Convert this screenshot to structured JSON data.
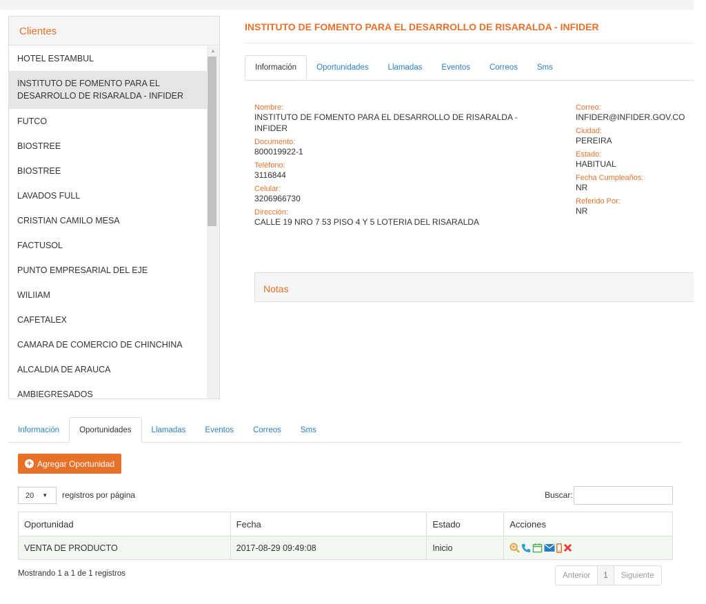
{
  "clients": {
    "header": "Clientes",
    "items": [
      "HOTEL ESTAMBUL",
      "INSTITUTO DE FOMENTO PARA EL DESARROLLO DE RISARALDA - INFIDER",
      "FUTCO",
      "BIOSTREE",
      "BIOSTREE",
      "LAVADOS FULL",
      "CRISTIAN CAMILO MESA",
      "FACTUSOL",
      "PUNTO EMPRESARIAL DEL EJE",
      "WILIIAM",
      "CAFETALEX",
      "CAMARA DE COMERCIO DE CHINCHINA",
      "ALCALDIA DE ARAUCA",
      "AMBIEGRESADOS"
    ],
    "selected_index": 1
  },
  "detail": {
    "title": "INSTITUTO DE FOMENTO PARA EL DESARROLLO DE RISARALDA - INFIDER",
    "tabs": [
      "Información",
      "Oportunidades",
      "Llamadas",
      "Eventos",
      "Correos",
      "Sms"
    ],
    "active_tab": "Información",
    "left": {
      "nombre_label": "Nombre:",
      "nombre": "INSTITUTO DE FOMENTO PARA EL DESARROLLO DE RISARALDA - INFIDER",
      "documento_label": "Documento:",
      "documento": "800019922-1",
      "telefono_label": "Teléfono:",
      "telefono": "3116844",
      "celular_label": "Celular:",
      "celular": "3206966730",
      "direccion_label": "Dirección:",
      "direccion": "CALLE 19 NRO 7 53 PISO 4 Y 5 LOTERIA DEL RISARALDA"
    },
    "right": {
      "correo_label": "Correo:",
      "correo": "INFIDER@INFIDER.GOV.CO",
      "ciudad_label": "Ciudad:",
      "ciudad": "PEREIRA",
      "estado_label": "Estado:",
      "estado": "HABITUAL",
      "cumple_label": "Fecha Cumpleaños:",
      "cumple": "NR",
      "referido_label": "Referido Por:",
      "referido": "NR"
    },
    "notes_label": "Notas"
  },
  "opportunities": {
    "tabs": [
      "Información",
      "Oportunidades",
      "Llamadas",
      "Eventos",
      "Correos",
      "Sms"
    ],
    "active_tab": "Oportunidades",
    "add_label": "Agregar Oportunidad",
    "page_length": "20",
    "page_length_label": "registros por página",
    "search_label": "Buscar:",
    "search_value": "",
    "columns": [
      "Oportunidad",
      "Fecha",
      "Estado",
      "Acciones"
    ],
    "rows": [
      {
        "oportunidad": "VENTA DE PRODUCTO",
        "fecha": "2017-08-29 09:49:08",
        "estado": "Inicio"
      }
    ],
    "footer_info": "Mostrando 1 a 1 de 1 registros",
    "pager": {
      "prev": "Anterior",
      "current": "1",
      "next": "Siguiente"
    }
  },
  "colors": {
    "accent": "#e8712a",
    "link": "#2a7fc4",
    "row_highlight": "#f2f8f1",
    "icon_view": "#e8712a",
    "icon_call": "#2a9fd6",
    "icon_event": "#4caf50",
    "icon_mail": "#2a7fc4",
    "icon_delete": "#e53935"
  }
}
